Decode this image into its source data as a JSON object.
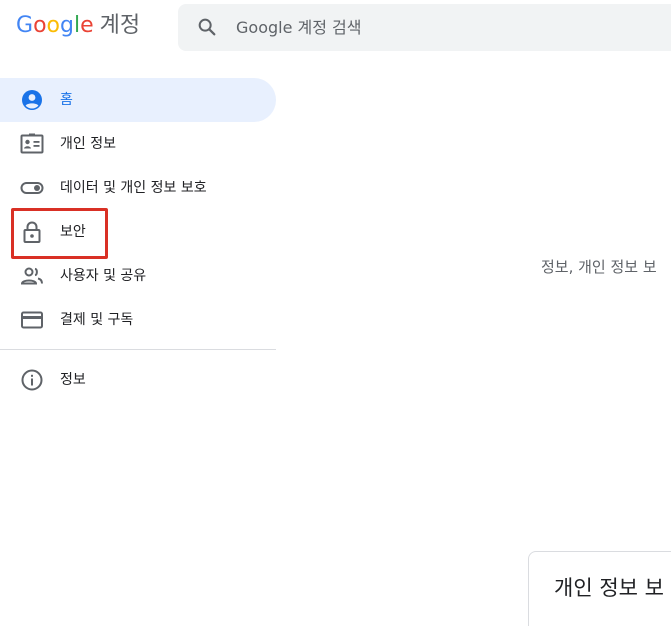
{
  "header": {
    "logo_letters": [
      "G",
      "o",
      "o",
      "g",
      "l",
      "e"
    ],
    "product_name": "계정",
    "search_placeholder": "Google 계정 검색"
  },
  "sidebar": {
    "items": [
      {
        "label": "홈",
        "icon": "account-circle-icon",
        "active": true
      },
      {
        "label": "개인 정보",
        "icon": "id-card-icon",
        "active": false
      },
      {
        "label": "데이터 및 개인 정보 보호",
        "icon": "toggle-icon",
        "active": false
      },
      {
        "label": "보안",
        "icon": "lock-icon",
        "active": false
      },
      {
        "label": "사용자 및 공유",
        "icon": "people-icon",
        "active": false
      },
      {
        "label": "결제 및 구독",
        "icon": "credit-card-icon",
        "active": false
      }
    ],
    "secondary_items": [
      {
        "label": "정보",
        "icon": "info-icon",
        "active": false
      }
    ]
  },
  "main": {
    "intro_text": "정보, 개인 정보 보",
    "card_title": "개인 정보 보 정"
  },
  "colors": {
    "accent": "#1a73e8",
    "active_bg": "#e8f0fe",
    "highlight": "#d93025",
    "search_bg": "#f1f3f4"
  }
}
